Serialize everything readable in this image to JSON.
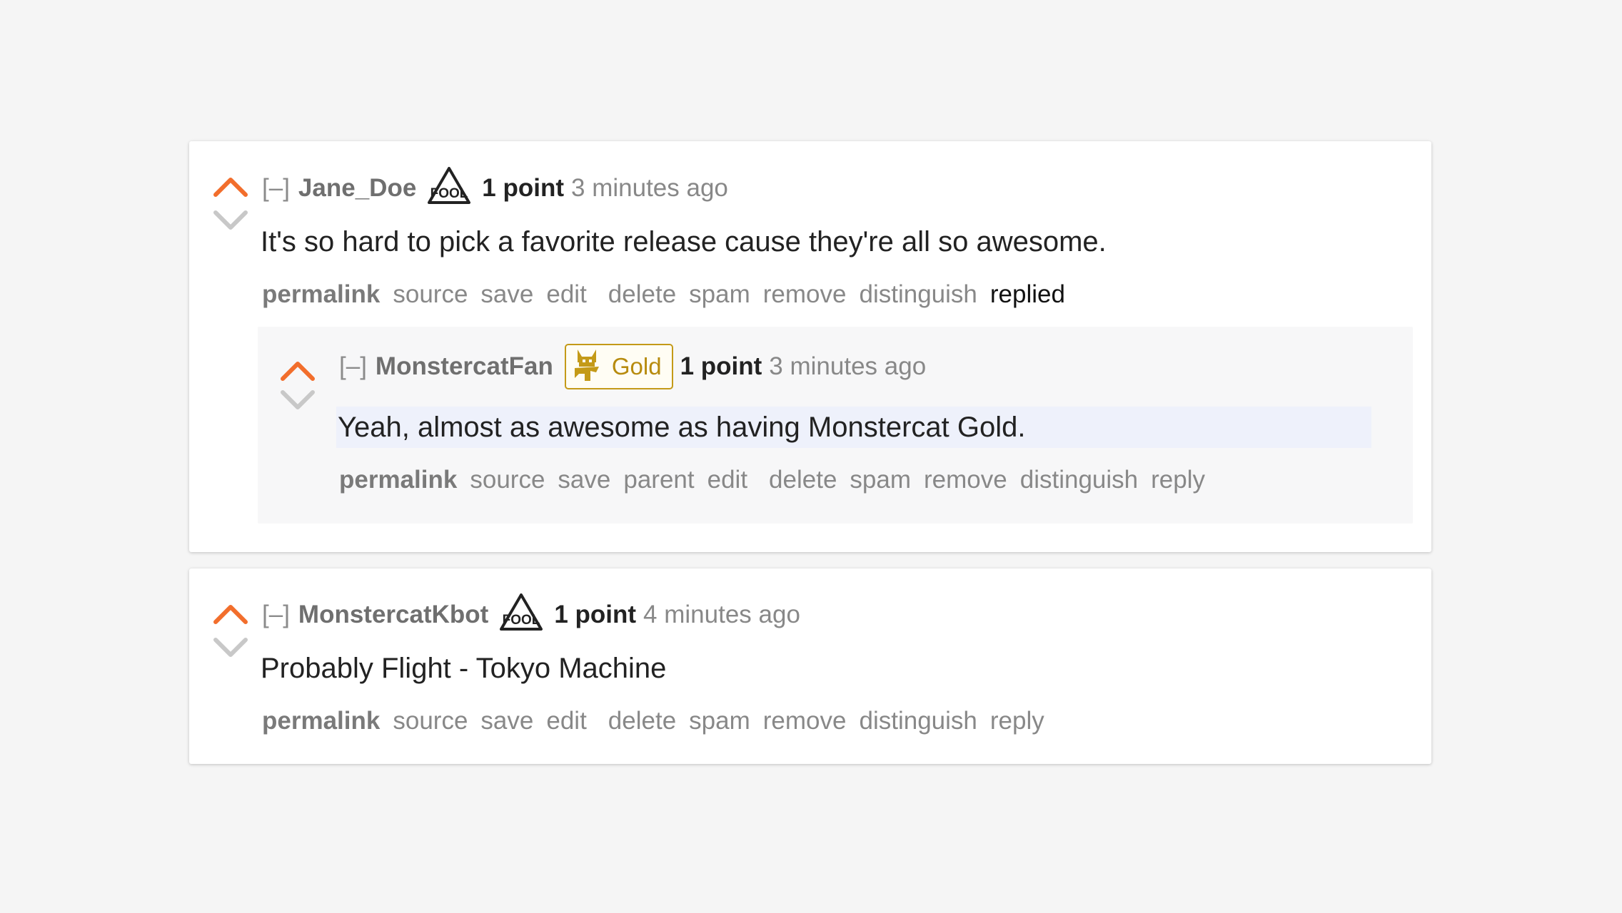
{
  "colors": {
    "upvote": "#f26e2c",
    "downvote": "#c8c8c8",
    "gold": "#c49a18",
    "background": "#f5f5f5"
  },
  "icons": {
    "upvote": "upvote-arrow-icon",
    "downvote": "downvote-arrow-icon",
    "flair": "triangle-fool-flair-icon",
    "gold": "monstercat-gold-icon"
  },
  "comments": [
    {
      "collapse": "[–]",
      "author": "Jane_Doe",
      "flair_text": "FOOL",
      "score": "1 point",
      "time": "3 minutes ago",
      "body": "It's so hard to pick a favorite release cause they're all so awesome.",
      "buttons": [
        "permalink",
        "source",
        "save",
        "edit",
        "delete",
        "spam",
        "remove",
        "distinguish",
        "replied"
      ],
      "replies": [
        {
          "collapse": "[–]",
          "author": "MonstercatFan",
          "badge": "Gold",
          "score": "1 point",
          "time": "3 minutes ago",
          "body": "Yeah, almost as awesome as having Monstercat Gold.",
          "buttons": [
            "permalink",
            "source",
            "save",
            "parent",
            "edit",
            "delete",
            "spam",
            "remove",
            "distinguish",
            "reply"
          ]
        }
      ]
    },
    {
      "collapse": "[–]",
      "author": "MonstercatKbot",
      "flair_text": "FOOL",
      "score": "1 point",
      "time": "4 minutes ago",
      "body": "Probably Flight - Tokyo Machine",
      "buttons": [
        "permalink",
        "source",
        "save",
        "edit",
        "delete",
        "spam",
        "remove",
        "distinguish",
        "reply"
      ]
    }
  ]
}
